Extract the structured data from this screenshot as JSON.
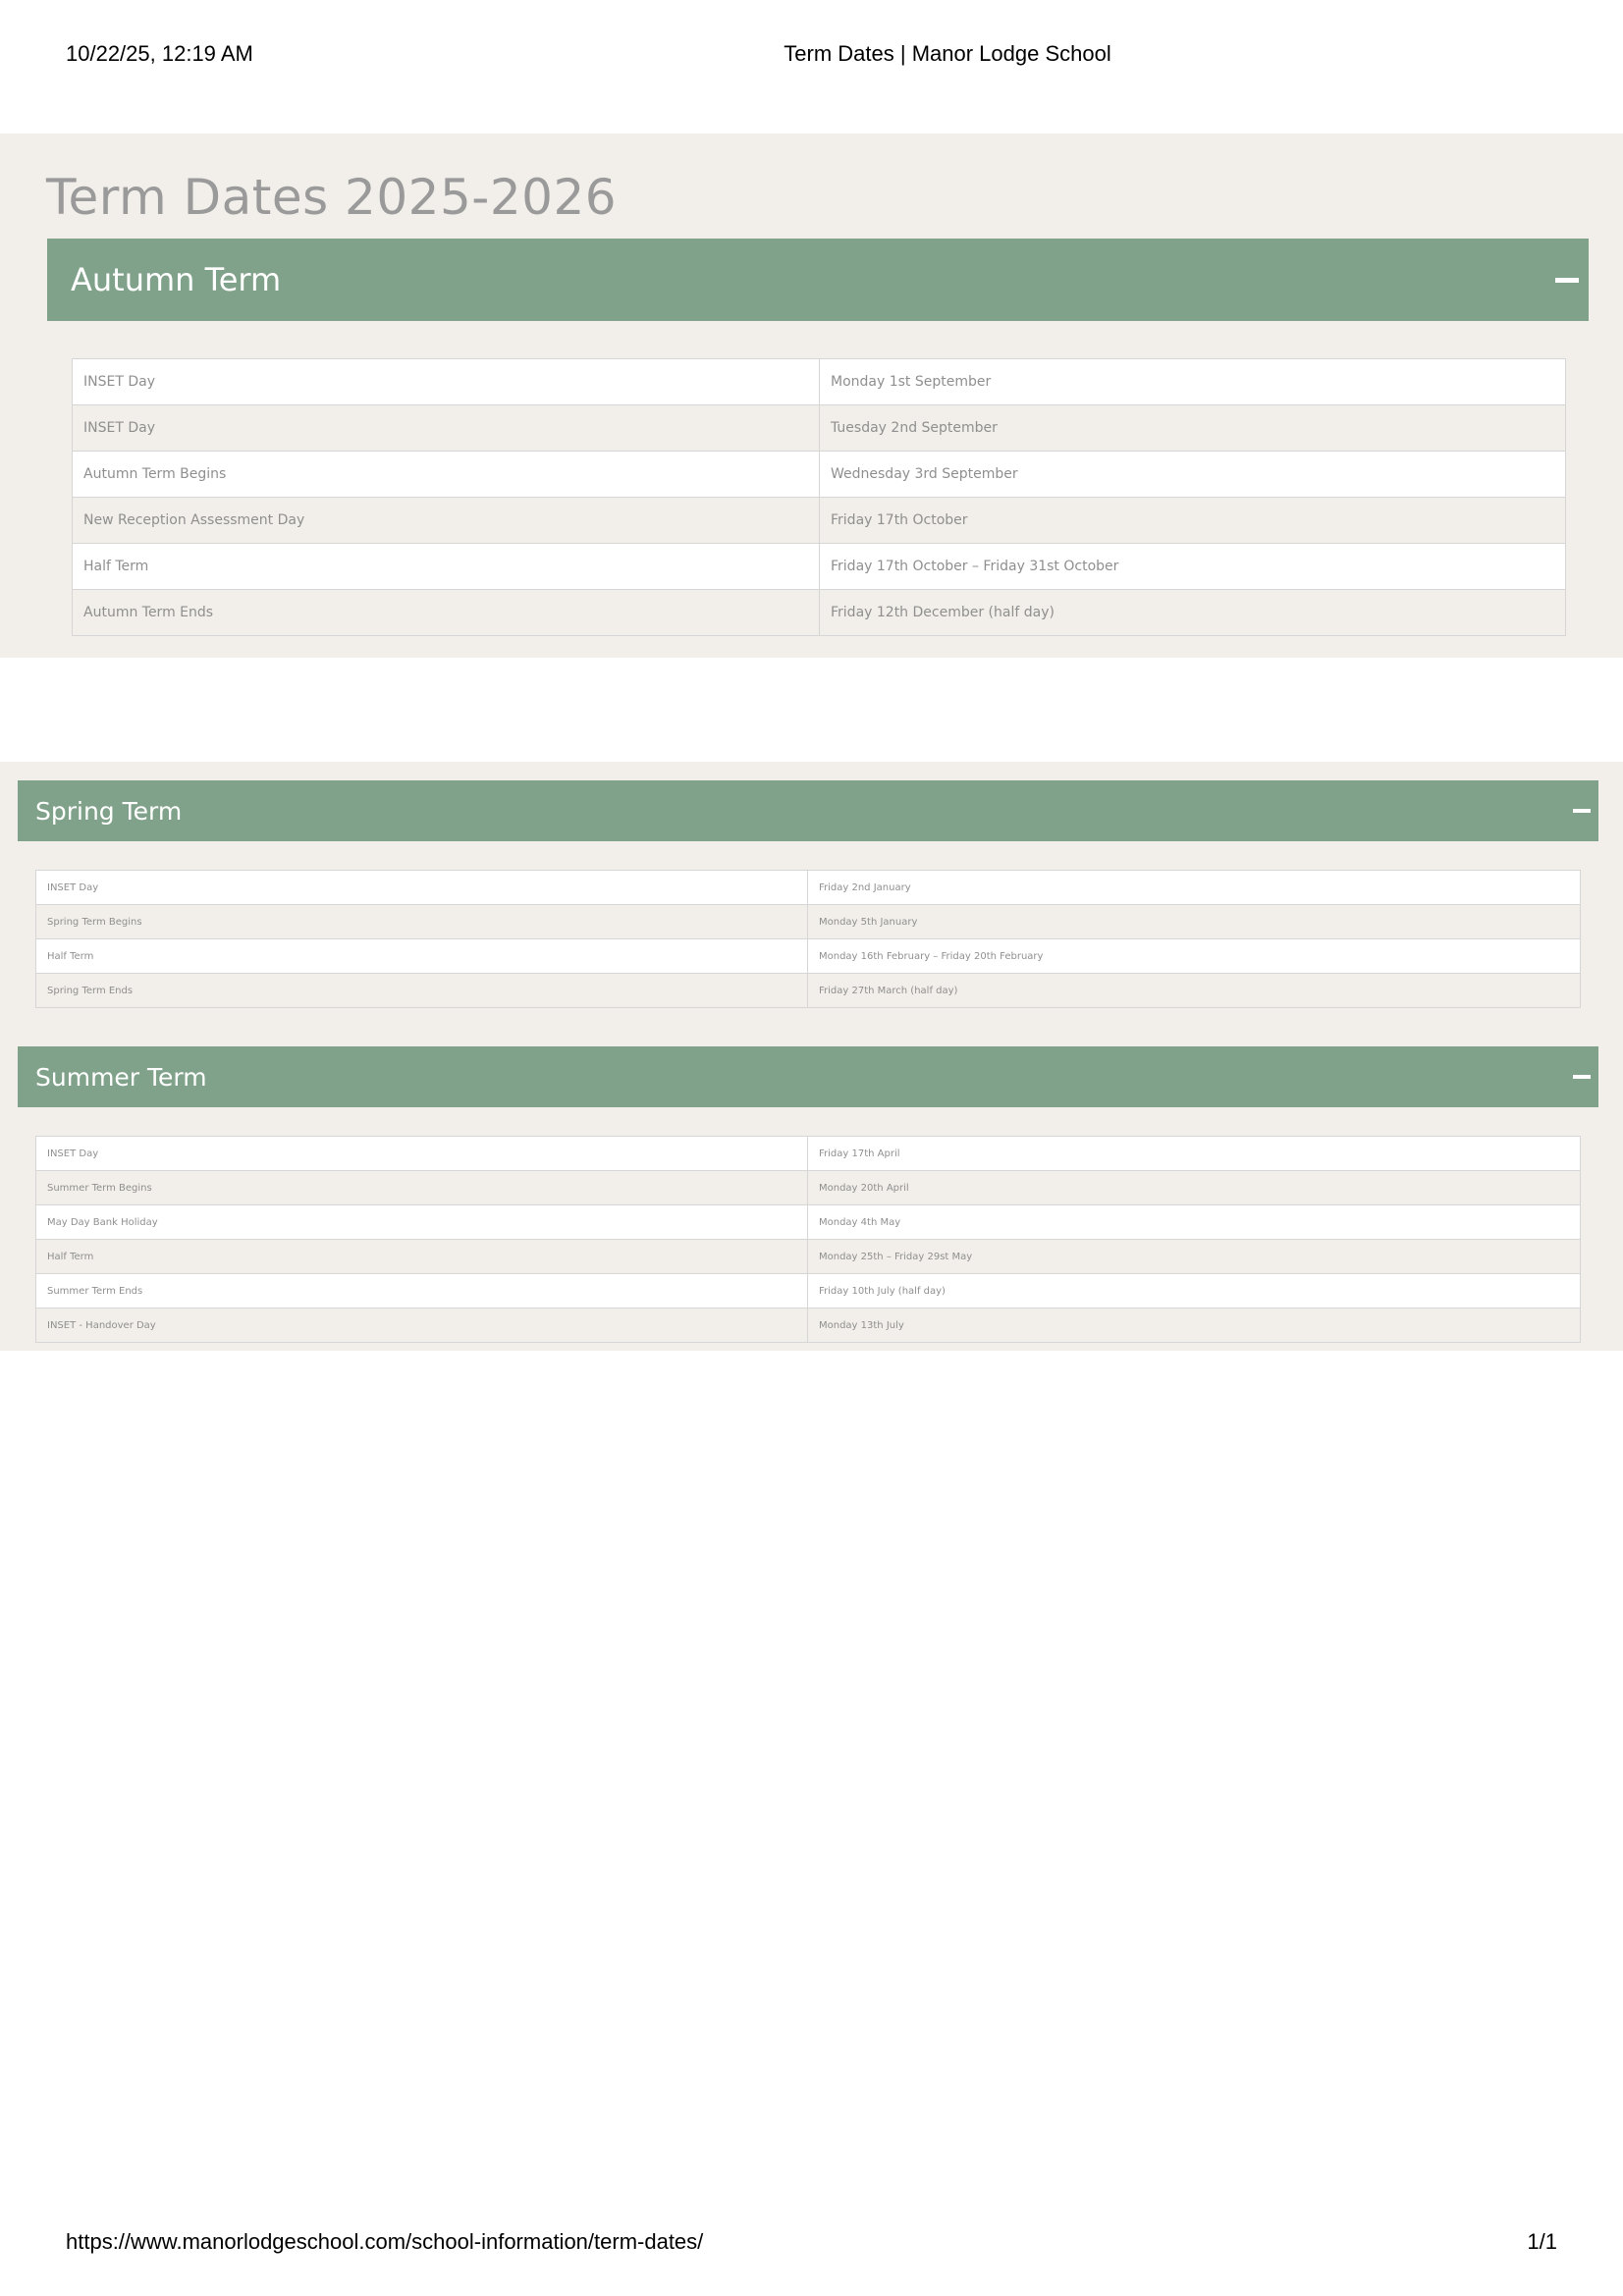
{
  "print_header": {
    "datetime": "10/22/25, 12:19 AM",
    "page_title": "Term Dates | Manor Lodge School"
  },
  "print_footer": {
    "url": "https://www.manorlodgeschool.com/school-information/term-dates/",
    "page_number": "1/1"
  },
  "page": {
    "title": "Term Dates 2025-2026"
  },
  "icons": {
    "collapse": "minus-icon"
  },
  "colors": {
    "term_header_bg": "#80a28a",
    "band_bg": "#f2efea",
    "title_text": "#9a9a9a"
  },
  "terms": [
    {
      "name": "Autumn Term",
      "rows": [
        {
          "event": "INSET Day",
          "date": "Monday 1st September"
        },
        {
          "event": "INSET Day",
          "date": "Tuesday 2nd September"
        },
        {
          "event": "Autumn Term Begins",
          "date": "Wednesday 3rd September"
        },
        {
          "event": "New Reception Assessment Day",
          "date": "Friday 17th October"
        },
        {
          "event": "Half Term",
          "date": "Friday 17th October – Friday 31st October"
        },
        {
          "event": "Autumn Term Ends",
          "date": "Friday 12th December (half day)"
        }
      ]
    },
    {
      "name": "Spring Term",
      "rows": [
        {
          "event": "INSET Day",
          "date": "Friday 2nd January"
        },
        {
          "event": "Spring Term Begins",
          "date": "Monday 5th January"
        },
        {
          "event": "Half Term",
          "date": "Monday 16th February – Friday 20th February"
        },
        {
          "event": "Spring Term Ends",
          "date": "Friday 27th March (half day)"
        }
      ]
    },
    {
      "name": "Summer Term",
      "rows": [
        {
          "event": "INSET Day",
          "date": "Friday 17th April"
        },
        {
          "event": "Summer Term Begins",
          "date": "Monday 20th April"
        },
        {
          "event": "May Day Bank Holiday",
          "date": "Monday 4th May"
        },
        {
          "event": "Half Term",
          "date": "Monday 25th – Friday 29st May"
        },
        {
          "event": "Summer Term Ends",
          "date": "Friday 10th July (half day)"
        },
        {
          "event": "INSET - Handover Day",
          "date": "Monday 13th July"
        }
      ]
    }
  ]
}
